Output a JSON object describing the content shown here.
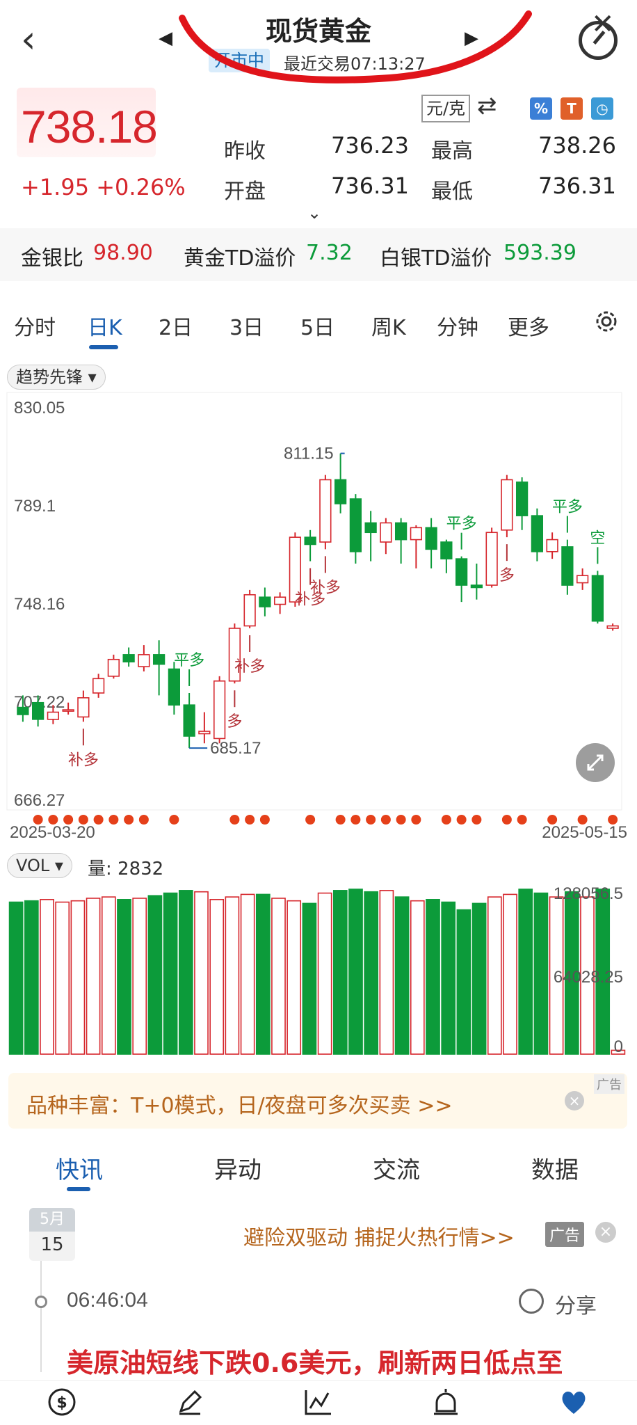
{
  "header": {
    "title": "现货黄金",
    "market_status": "开市中",
    "last_trade": "最近交易07:13:27"
  },
  "quote": {
    "price": "738.18",
    "change": "+1.95 +0.26%",
    "unit": "元/克",
    "stats": [
      {
        "label": "昨收",
        "value": "736.23"
      },
      {
        "label": "最高",
        "value": "738.26"
      },
      {
        "label": "开盘",
        "value": "736.31"
      },
      {
        "label": "最低",
        "value": "736.31"
      }
    ]
  },
  "ratios": [
    {
      "label": "金银比",
      "value": "98.90",
      "color": "#d6262c"
    },
    {
      "label": "黄金TD溢价",
      "value": "7.32",
      "color": "#0c9b3a"
    },
    {
      "label": "白银TD溢价",
      "value": "593.39",
      "color": "#0c9b3a"
    }
  ],
  "tabs": [
    "分时",
    "日K",
    "2日",
    "3日",
    "5日",
    "周K",
    "分钟",
    "更多"
  ],
  "active_tab": "日K",
  "indicator": "趋势先锋",
  "chart_data": {
    "type": "candlestick",
    "y_ticks": [
      "830.05",
      "789.1",
      "748.16",
      "707.22",
      "666.27"
    ],
    "ylim": [
      666.27,
      830.05
    ],
    "x_start": "2025-03-20",
    "x_end": "2025-05-15",
    "max_label": "811.15",
    "min_label": "685.17",
    "candles": [
      {
        "o": 705,
        "c": 702,
        "h": 710,
        "l": 699
      },
      {
        "o": 707,
        "c": 700,
        "h": 710,
        "l": 697
      },
      {
        "o": 700,
        "c": 703,
        "h": 706,
        "l": 698
      },
      {
        "o": 704,
        "c": 704,
        "h": 707,
        "l": 702
      },
      {
        "o": 701,
        "c": 709,
        "h": 712,
        "l": 699
      },
      {
        "o": 711,
        "c": 717,
        "h": 719,
        "l": 709
      },
      {
        "o": 718,
        "c": 725,
        "h": 727,
        "l": 717
      },
      {
        "o": 727,
        "c": 724,
        "h": 730,
        "l": 722
      },
      {
        "o": 722,
        "c": 727,
        "h": 731,
        "l": 720
      },
      {
        "o": 727,
        "c": 723,
        "h": 733,
        "l": 710
      },
      {
        "o": 721,
        "c": 706,
        "h": 724,
        "l": 702
      },
      {
        "o": 706,
        "c": 693,
        "h": 711,
        "l": 688
      },
      {
        "o": 694,
        "c": 695,
        "h": 703,
        "l": 690
      },
      {
        "o": 692,
        "c": 716,
        "h": 718,
        "l": 690
      },
      {
        "o": 716,
        "c": 738,
        "h": 740,
        "l": 715
      },
      {
        "o": 739,
        "c": 752,
        "h": 754,
        "l": 738
      },
      {
        "o": 751,
        "c": 747,
        "h": 755,
        "l": 743
      },
      {
        "o": 748,
        "c": 751,
        "h": 753,
        "l": 744
      },
      {
        "o": 749,
        "c": 776,
        "h": 778,
        "l": 747
      },
      {
        "o": 776,
        "c": 773,
        "h": 779,
        "l": 766
      },
      {
        "o": 774,
        "c": 800,
        "h": 802,
        "l": 771
      },
      {
        "o": 800,
        "c": 790,
        "h": 811,
        "l": 786
      },
      {
        "o": 792,
        "c": 770,
        "h": 794,
        "l": 765
      },
      {
        "o": 782,
        "c": 778,
        "h": 787,
        "l": 766
      },
      {
        "o": 774,
        "c": 782,
        "h": 784,
        "l": 769
      },
      {
        "o": 782,
        "c": 775,
        "h": 784,
        "l": 765
      },
      {
        "o": 775,
        "c": 780,
        "h": 781,
        "l": 763
      },
      {
        "o": 780,
        "c": 771,
        "h": 784,
        "l": 763
      },
      {
        "o": 774,
        "c": 767,
        "h": 775,
        "l": 761
      },
      {
        "o": 767,
        "c": 756,
        "h": 768,
        "l": 749
      },
      {
        "o": 756,
        "c": 755,
        "h": 765,
        "l": 750
      },
      {
        "o": 756,
        "c": 778,
        "h": 780,
        "l": 755
      },
      {
        "o": 779,
        "c": 800,
        "h": 802,
        "l": 776
      },
      {
        "o": 799,
        "c": 785,
        "h": 801,
        "l": 779
      },
      {
        "o": 785,
        "c": 770,
        "h": 788,
        "l": 766
      },
      {
        "o": 770,
        "c": 775,
        "h": 778,
        "l": 767
      },
      {
        "o": 772,
        "c": 756,
        "h": 775,
        "l": 752
      },
      {
        "o": 757,
        "c": 760,
        "h": 763,
        "l": 754
      },
      {
        "o": 760,
        "c": 741,
        "h": 762,
        "l": 740
      },
      {
        "o": 738,
        "c": 739,
        "h": 740,
        "l": 737
      }
    ],
    "signals": [
      {
        "index": 4,
        "text": "补多"
      },
      {
        "index": 11,
        "text": "平多"
      },
      {
        "index": 14,
        "text": "多"
      },
      {
        "index": 15,
        "text": "补多"
      },
      {
        "index": 19,
        "text": "补多"
      },
      {
        "index": 20,
        "text": "补多"
      },
      {
        "index": 29,
        "text": "平多"
      },
      {
        "index": 32,
        "text": "多"
      },
      {
        "index": 36,
        "text": "平多"
      },
      {
        "index": 38,
        "text": "空"
      }
    ],
    "volume": {
      "label": "VOL",
      "amount": "量: 2832",
      "y_ticks": [
        "128056.5",
        "64028.25",
        "0"
      ],
      "values": [
        118,
        119,
        120,
        118,
        119,
        121,
        122,
        120,
        121,
        123,
        125,
        127,
        126,
        120,
        122,
        124,
        124,
        121,
        119,
        117,
        125,
        127,
        128,
        126,
        127,
        122,
        119,
        120,
        118,
        112,
        117,
        122,
        124,
        128,
        125,
        122,
        126,
        122,
        128,
        3
      ]
    }
  },
  "ad_banner": "品种丰富：T+0模式，日/夜盘可多次买卖 >>",
  "ad_tag": "广告",
  "news_tabs": [
    "快讯",
    "异动",
    "交流",
    "数据"
  ],
  "news": {
    "month": "5月",
    "day": "15",
    "promo": "避险双驱动 捕捉火热行情>>",
    "promo_tag": "广告",
    "time": "06:46:04",
    "share": "分享",
    "headline": "美原油短线下跌0.6美元，刷新两日低点至"
  },
  "colors": {
    "up": "#d6262c",
    "down": "#0c9b3a",
    "accent": "#1b5fb0"
  }
}
